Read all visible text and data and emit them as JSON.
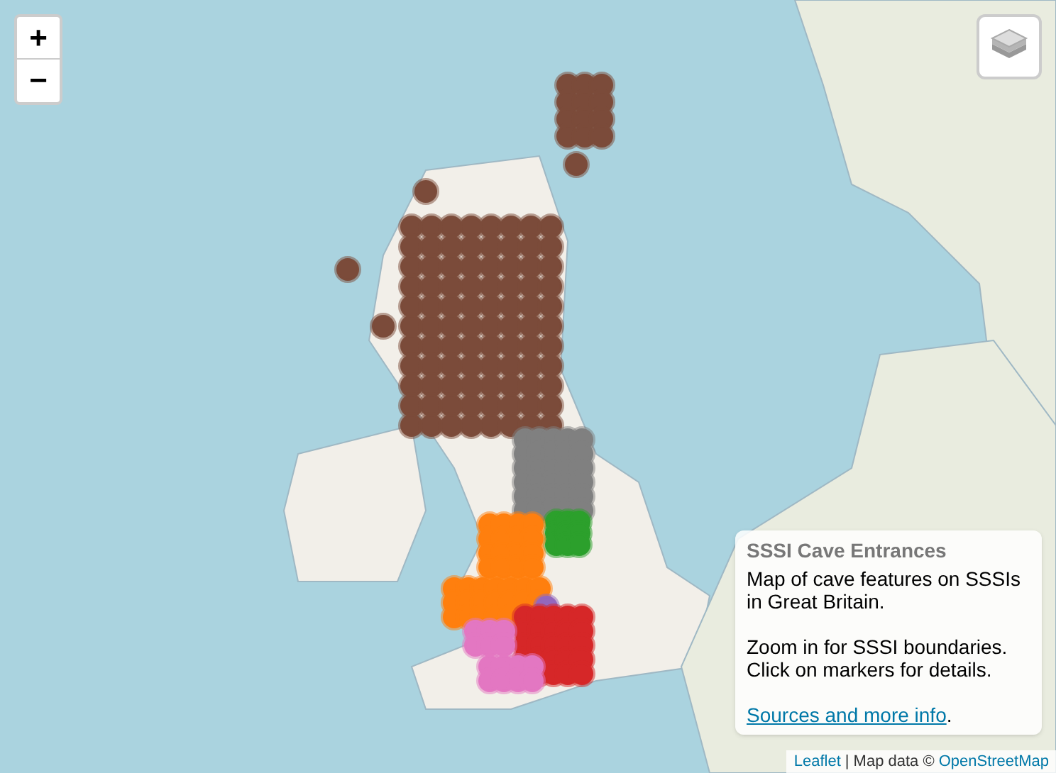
{
  "zoom_controls": {
    "zoom_in": "+",
    "zoom_out": "−"
  },
  "info_panel": {
    "title": "SSSI Cave Entrances",
    "paragraphs": [
      "Map of cave features on SSSIs in Great Britain.",
      "Zoom in for SSSI boundaries. Click on markers for details."
    ],
    "link": {
      "text": "Sources and more info",
      "suffix": "."
    }
  },
  "attribution": {
    "leaflet": "Leaflet",
    "middle": "| Map data ©",
    "osm": "OpenStreetMap"
  }
}
